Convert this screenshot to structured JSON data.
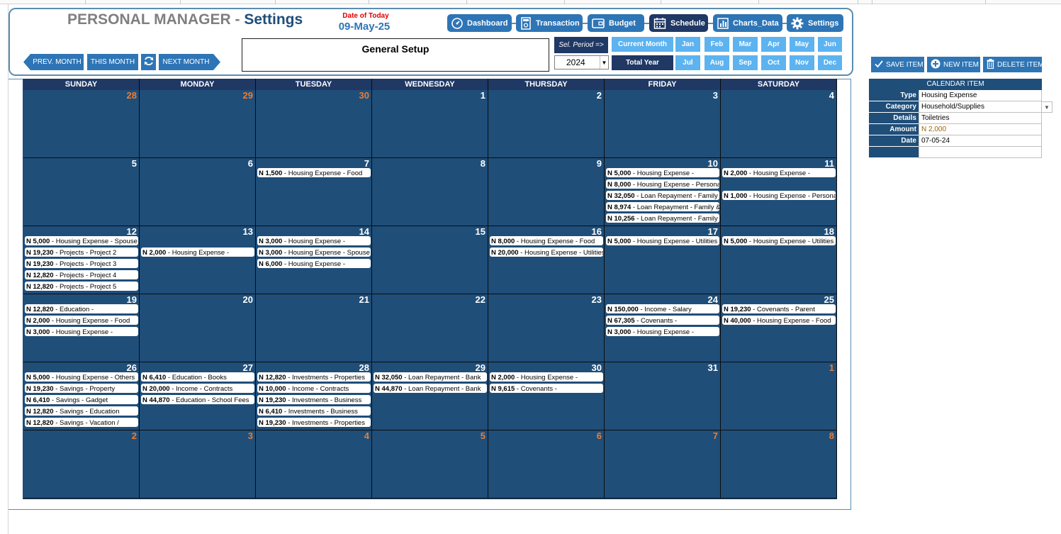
{
  "header": {
    "app_name": "PERSONAL MANAGER",
    "separator": " - ",
    "page_name": "Settings",
    "today_label": "Date of Today",
    "today_value": "09-May-25"
  },
  "nav": {
    "dashboard": "Dashboard",
    "transaction": "Transaction",
    "budget": "Budget",
    "schedule": "Schedule",
    "charts_data": "Charts_Data",
    "settings": "Settings"
  },
  "month_nav": {
    "prev": "PREV. MONTH",
    "this": "THIS MONTH",
    "next": "NEXT MONTH"
  },
  "setup": {
    "title": "General Setup"
  },
  "period": {
    "sel_label": "Sel. Period =>",
    "year": "2024",
    "current_month": "Current Month",
    "total_year": "Total Year",
    "months_top": [
      "Jan",
      "Feb",
      "Mar",
      "Apr",
      "May",
      "Jun"
    ],
    "months_bottom": [
      "Jul",
      "Aug",
      "Sep",
      "Oct",
      "Nov",
      "Dec"
    ]
  },
  "actions": {
    "save": "SAVE ITEM",
    "new": "NEW ITEM",
    "delete": "DELETE ITEM"
  },
  "calendar_item": {
    "title": "CALENDAR ITEM",
    "rows": [
      {
        "label": "Type",
        "value": "Housing Expense"
      },
      {
        "label": "Category",
        "value": "Household/Supplies"
      },
      {
        "label": "Details",
        "value": "Toiletries"
      },
      {
        "label": "Amount",
        "value": "N 2,000"
      },
      {
        "label": "Date",
        "value": "07-05-24"
      },
      {
        "label": "",
        "value": ""
      }
    ]
  },
  "calendar": {
    "days": [
      "SUNDAY",
      "MONDAY",
      "TUESDAY",
      "WEDNESDAY",
      "THURSDAY",
      "FRIDAY",
      "SATURDAY"
    ],
    "weeks": [
      [
        {
          "day": "28",
          "other": true,
          "events": []
        },
        {
          "day": "29",
          "other": true,
          "events": []
        },
        {
          "day": "30",
          "other": true,
          "events": []
        },
        {
          "day": "1",
          "other": false,
          "events": []
        },
        {
          "day": "2",
          "other": false,
          "events": []
        },
        {
          "day": "3",
          "other": false,
          "events": []
        },
        {
          "day": "4",
          "other": false,
          "events": []
        }
      ],
      [
        {
          "day": "5",
          "other": false,
          "events": []
        },
        {
          "day": "6",
          "other": false,
          "events": []
        },
        {
          "day": "7",
          "other": false,
          "events": [
            {
              "amt": "N 1,500",
              "desc": " - Housing Expense - Food"
            }
          ]
        },
        {
          "day": "8",
          "other": false,
          "events": []
        },
        {
          "day": "9",
          "other": false,
          "events": []
        },
        {
          "day": "10",
          "other": false,
          "events": [
            {
              "amt": "N 5,000",
              "desc": " - Housing Expense -"
            },
            {
              "amt": "N 8,000",
              "desc": " - Housing Expense - Personal"
            },
            {
              "amt": "N 32,050",
              "desc": " - Loan Repayment - Family"
            },
            {
              "amt": "N 8,974",
              "desc": " - Loan Repayment - Family &"
            },
            {
              "amt": "N 10,256",
              "desc": " - Loan Repayment - Family"
            }
          ]
        },
        {
          "day": "11",
          "other": false,
          "events": [
            {
              "amt": "N 2,000",
              "desc": " - Housing Expense -"
            },
            {
              "amt": "",
              "desc": ""
            },
            {
              "amt": "N 1,000",
              "desc": " - Housing Expense - Personal"
            }
          ]
        }
      ],
      [
        {
          "day": "12",
          "other": false,
          "events": [
            {
              "amt": "N 5,000",
              "desc": " - Housing Expense - Spouse"
            },
            {
              "amt": "N 19,230",
              "desc": " - Projects - Project 2"
            },
            {
              "amt": "N 19,230",
              "desc": " - Projects - Project 3"
            },
            {
              "amt": "N 12,820",
              "desc": " - Projects - Project 4"
            },
            {
              "amt": "N 12,820",
              "desc": " - Projects - Project 5"
            }
          ]
        },
        {
          "day": "13",
          "other": false,
          "events": [
            {
              "amt": "",
              "desc": ""
            },
            {
              "amt": "N 2,000",
              "desc": " - Housing Expense -"
            }
          ]
        },
        {
          "day": "14",
          "other": false,
          "events": [
            {
              "amt": "N 3,000",
              "desc": " - Housing Expense -"
            },
            {
              "amt": "N 3,000",
              "desc": " - Housing Expense - Spouse"
            },
            {
              "amt": "N 6,000",
              "desc": " - Housing Expense -"
            }
          ]
        },
        {
          "day": "15",
          "other": false,
          "events": []
        },
        {
          "day": "16",
          "other": false,
          "events": [
            {
              "amt": "N 8,000",
              "desc": " - Housing Expense - Food"
            },
            {
              "amt": "N 20,000",
              "desc": " - Housing Expense - Utilities"
            }
          ]
        },
        {
          "day": "17",
          "other": false,
          "events": [
            {
              "amt": "N 5,000",
              "desc": " - Housing Expense - Utilities"
            }
          ]
        },
        {
          "day": "18",
          "other": false,
          "events": [
            {
              "amt": "N 5,000",
              "desc": " - Housing Expense - Utilities"
            }
          ]
        }
      ],
      [
        {
          "day": "19",
          "other": false,
          "events": [
            {
              "amt": "N 12,820",
              "desc": " - Education -"
            },
            {
              "amt": "N 2,000",
              "desc": " - Housing Expense - Food"
            },
            {
              "amt": "N 3,000",
              "desc": " - Housing Expense -"
            }
          ]
        },
        {
          "day": "20",
          "other": false,
          "events": []
        },
        {
          "day": "21",
          "other": false,
          "events": []
        },
        {
          "day": "22",
          "other": false,
          "events": []
        },
        {
          "day": "23",
          "other": false,
          "events": []
        },
        {
          "day": "24",
          "other": false,
          "events": [
            {
              "amt": "N 150,000",
              "desc": " - Income - Salary"
            },
            {
              "amt": "N 67,305",
              "desc": " - Covenants -"
            },
            {
              "amt": "N 3,000",
              "desc": " - Housing Expense -"
            }
          ]
        },
        {
          "day": "25",
          "other": false,
          "events": [
            {
              "amt": "N 19,230",
              "desc": " - Covenants - Parent"
            },
            {
              "amt": "N 40,000",
              "desc": " - Housing Expense - Food"
            }
          ]
        }
      ],
      [
        {
          "day": "26",
          "other": false,
          "events": [
            {
              "amt": "N 5,000",
              "desc": " - Housing Expense - Others"
            },
            {
              "amt": "N 19,230",
              "desc": " - Savings - Property"
            },
            {
              "amt": "N 6,410",
              "desc": " - Savings - Gadget"
            },
            {
              "amt": "N 12,820",
              "desc": " - Savings - Education"
            },
            {
              "amt": "N 12,820",
              "desc": " - Savings - Vacation /"
            }
          ]
        },
        {
          "day": "27",
          "other": false,
          "events": [
            {
              "amt": "N 6,410",
              "desc": " - Education - Books"
            },
            {
              "amt": "N 20,000",
              "desc": " - Income - Contracts"
            },
            {
              "amt": "N 44,870",
              "desc": " - Education - School Fees"
            }
          ]
        },
        {
          "day": "28",
          "other": false,
          "events": [
            {
              "amt": "N 12,820",
              "desc": " - Investments - Properties"
            },
            {
              "amt": "N 10,000",
              "desc": " - Income - Contracts"
            },
            {
              "amt": "N 19,230",
              "desc": " - Investments - Business"
            },
            {
              "amt": "N 6,410",
              "desc": " - Investments - Business"
            },
            {
              "amt": "N 19,230",
              "desc": " - Investments - Properties"
            }
          ]
        },
        {
          "day": "29",
          "other": false,
          "events": [
            {
              "amt": "N 32,050",
              "desc": " - Loan Repayment - Bank"
            },
            {
              "amt": "N 44,870",
              "desc": " - Loan Repayment - Bank"
            }
          ]
        },
        {
          "day": "30",
          "other": false,
          "events": [
            {
              "amt": "N 2,000",
              "desc": " - Housing Expense -"
            },
            {
              "amt": "N 9,615",
              "desc": " - Covenants -"
            }
          ]
        },
        {
          "day": "31",
          "other": false,
          "events": []
        },
        {
          "day": "1",
          "other": true,
          "events": []
        }
      ],
      [
        {
          "day": "2",
          "other": true,
          "events": []
        },
        {
          "day": "3",
          "other": true,
          "events": []
        },
        {
          "day": "4",
          "other": true,
          "events": []
        },
        {
          "day": "5",
          "other": true,
          "events": []
        },
        {
          "day": "6",
          "other": true,
          "events": []
        },
        {
          "day": "7",
          "other": true,
          "events": []
        },
        {
          "day": "8",
          "other": true,
          "events": []
        }
      ]
    ]
  },
  "colors": {
    "cell_blue": "#1f4e79",
    "header_navy": "#1f3864",
    "button_blue": "#2e75b6",
    "month_light": "#5cb3f0",
    "other_month_day": "#ed7d31",
    "today_label_red": "#e00000"
  },
  "icons": {
    "dashboard": "gauge-icon",
    "transaction": "register-icon",
    "budget": "wallet-icon",
    "schedule": "calendar-icon",
    "charts_data": "bar-chart-icon",
    "settings": "gear-icon",
    "refresh": "refresh-icon",
    "save": "checkmark-icon",
    "new": "plus-circle-icon",
    "delete": "trash-icon"
  }
}
